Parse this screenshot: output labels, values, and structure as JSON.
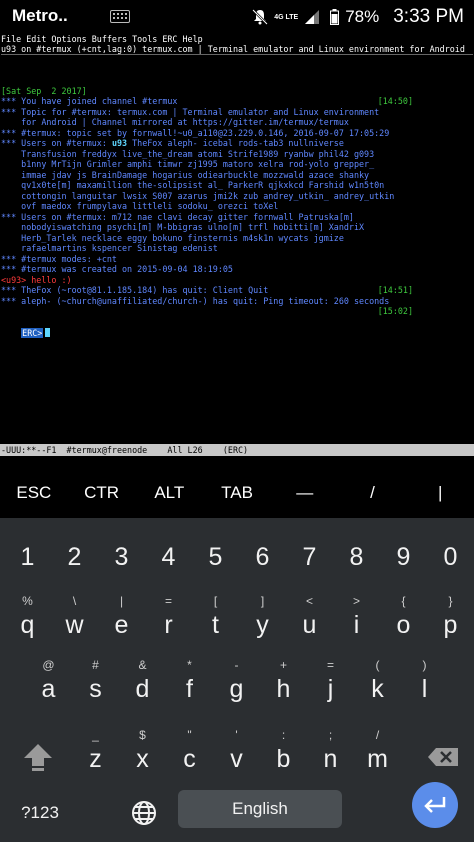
{
  "status_bar": {
    "carrier": "Metro..",
    "network_type": "4G LTE",
    "battery": "78%",
    "time": "3:33 PM",
    "icons": [
      "keyboard-icon",
      "mute-icon",
      "signal-icon",
      "battery-icon"
    ]
  },
  "terminal": {
    "menubar": "File Edit Options Buffers Tools ERC Help",
    "header": "u93 on #termux (+cnt,lag:0) termux.com | Terminal emulator and Linux environment for Android",
    "date_line": "[Sat Sep  2 2017]",
    "lines": [
      {
        "text": "*** You have joined channel #termux",
        "ts": "[14:50]"
      },
      {
        "text": "*** Topic for #termux: termux.com | Terminal emulator and Linux environment"
      },
      {
        "text": "    for Android | Channel mirrored at https://gitter.im/termux/termux"
      },
      {
        "text": "*** #termux: topic set by fornwall!~u0_a110@23.229.0.146, 2016-09-07 17:05:29"
      },
      {
        "text": "*** Users on #termux: ",
        "hl": "u93",
        "rest": " TheFox aleph- icebal rods-tab3 nullniverse"
      },
      {
        "text": "    Transfusion freddyx live_the_dream atomi Strife1989 ryanbw phil42 g093"
      },
      {
        "text": "    b1nny MrTijn Grimler amphi timwr zj1995 matoro xelra rod-yolo grepper_"
      },
      {
        "text": "    immae jdav js BrainDamage hogarius odiearbuckle mozzwald azace shanky"
      },
      {
        "text": "    qv1x0te[m] maxamillion the-solipsist al_ ParkerR qjkxkcd Farshid w1n5t0n"
      },
      {
        "text": "    cottongin languitar lwsix S007 azarus jmi2k zub andrey_utkin_ andrey_utkin"
      },
      {
        "text": "    ovf maedox frumpylava littleli sodoku_ orezci toXel"
      },
      {
        "text": "*** Users on #termux: m712 nae clavi decay gitter fornwall Patruska[m]"
      },
      {
        "text": "    nobodyiswatching psychi[m] M-bbigras ulno[m] trfl hobitti[m] XandriX"
      },
      {
        "text": "    Herb_Tarlek necklace eggy bokuno finsternis m4sk1n wycats jgmize"
      },
      {
        "text": "    rafaelmartins kspencer Sinistag edenist"
      },
      {
        "text": "*** #termux modes: +cnt"
      },
      {
        "text": "*** #termux was created on 2015-09-04 18:19:05"
      },
      {
        "me": "<u93> hello :)"
      },
      {
        "text": "*** TheFox (~root@81.1.185.184) has quit: Client Quit",
        "ts": "[14:51]"
      },
      {
        "text": "*** aleph- (~church@unaffiliated/church-) has quit: Ping timeout: 260 seconds"
      },
      {
        "ts_only": "[15:02]"
      }
    ],
    "prompt": "ERC>",
    "modeline": "-UUU:**--F1  #termux@freenode    All L26    (ERC)"
  },
  "extra_keys": [
    "ESC",
    "CTR",
    "ALT",
    "TAB",
    "—",
    "/",
    "|"
  ],
  "keyboard": {
    "numbers": [
      "1",
      "2",
      "3",
      "4",
      "5",
      "6",
      "7",
      "8",
      "9",
      "0"
    ],
    "row1": [
      {
        "key": "q",
        "alt": "%"
      },
      {
        "key": "w",
        "alt": "\\"
      },
      {
        "key": "e",
        "alt": "|"
      },
      {
        "key": "r",
        "alt": "="
      },
      {
        "key": "t",
        "alt": "["
      },
      {
        "key": "y",
        "alt": "]"
      },
      {
        "key": "u",
        "alt": "<"
      },
      {
        "key": "i",
        "alt": ">"
      },
      {
        "key": "o",
        "alt": "{"
      },
      {
        "key": "p",
        "alt": "}"
      }
    ],
    "row2": [
      {
        "key": "a",
        "alt": "@"
      },
      {
        "key": "s",
        "alt": "#"
      },
      {
        "key": "d",
        "alt": "&"
      },
      {
        "key": "f",
        "alt": "*"
      },
      {
        "key": "g",
        "alt": "-"
      },
      {
        "key": "h",
        "alt": "+"
      },
      {
        "key": "j",
        "alt": "="
      },
      {
        "key": "k",
        "alt": "("
      },
      {
        "key": "l",
        "alt": ")"
      }
    ],
    "row3": [
      {
        "key": "z",
        "alt": "_"
      },
      {
        "key": "x",
        "alt": "$"
      },
      {
        "key": "c",
        "alt": "\""
      },
      {
        "key": "v",
        "alt": "'"
      },
      {
        "key": "b",
        "alt": ":"
      },
      {
        "key": "n",
        "alt": ";"
      },
      {
        "key": "m",
        "alt": "/"
      }
    ],
    "symbols_label": "?123",
    "space_label": "English"
  }
}
